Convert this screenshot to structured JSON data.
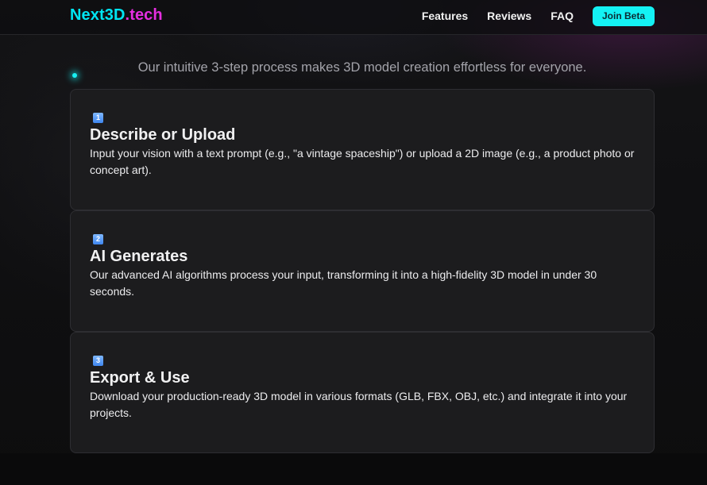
{
  "brand": {
    "part1": "Next3D",
    "part2": ".tech"
  },
  "nav": {
    "items": [
      "Features",
      "Reviews",
      "FAQ"
    ],
    "cta_label": "Join Beta"
  },
  "hero": {
    "subtitle": "Our intuitive 3-step process makes 3D model creation effortless for everyone."
  },
  "steps": [
    {
      "badge": "1",
      "title": "Describe or Upload",
      "description": "Input your vision with a text prompt (e.g., \"a vintage spaceship\") or upload a 2D image (e.g., a product photo or concept art)."
    },
    {
      "badge": "2",
      "title": "AI Generates",
      "description": "Our advanced AI algorithms process your input, transforming it into a high-fidelity 3D model in under 30 seconds."
    },
    {
      "badge": "3",
      "title": "Export & Use",
      "description": "Download your production-ready 3D model in various formats (GLB, FBX, OBJ, etc.) and integrate it into your projects."
    }
  ],
  "colors": {
    "brand_cyan": "#00e5f2",
    "brand_magenta": "#e52ee0",
    "cta_background": "#14f1f4",
    "card_background": "#1c1c1e",
    "page_background": "#0f0f10"
  }
}
